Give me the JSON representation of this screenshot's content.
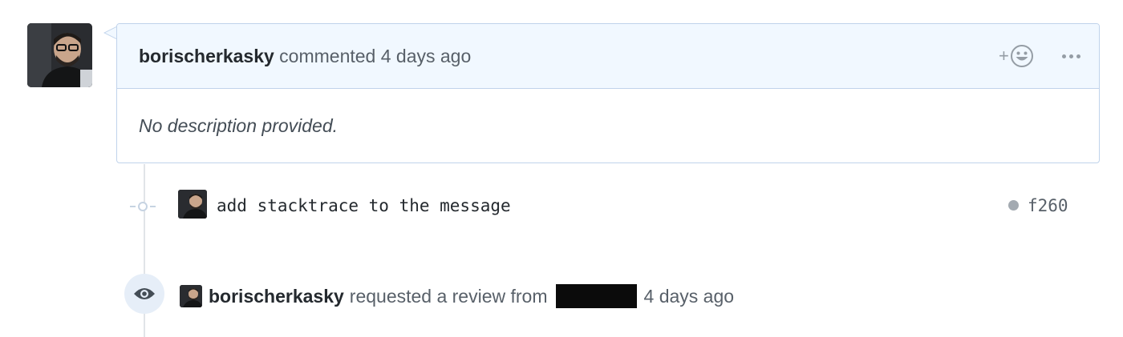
{
  "comment": {
    "author": "borischerkasky",
    "action": "commented",
    "time": "4 days ago",
    "body": "No description provided.",
    "reaction_plus": "+",
    "reaction_icon": "smiley-icon",
    "more_icon": "kebab-horizontal-icon"
  },
  "commit": {
    "message": "add stacktrace to the message",
    "sha": "f260",
    "status_color": "#a3aab1"
  },
  "review": {
    "author": "borischerkasky",
    "action": "requested a review from",
    "time": "4 days ago"
  },
  "colors": {
    "header_bg": "#f1f8ff",
    "border": "#c0d3eb",
    "muted": "#586069"
  }
}
